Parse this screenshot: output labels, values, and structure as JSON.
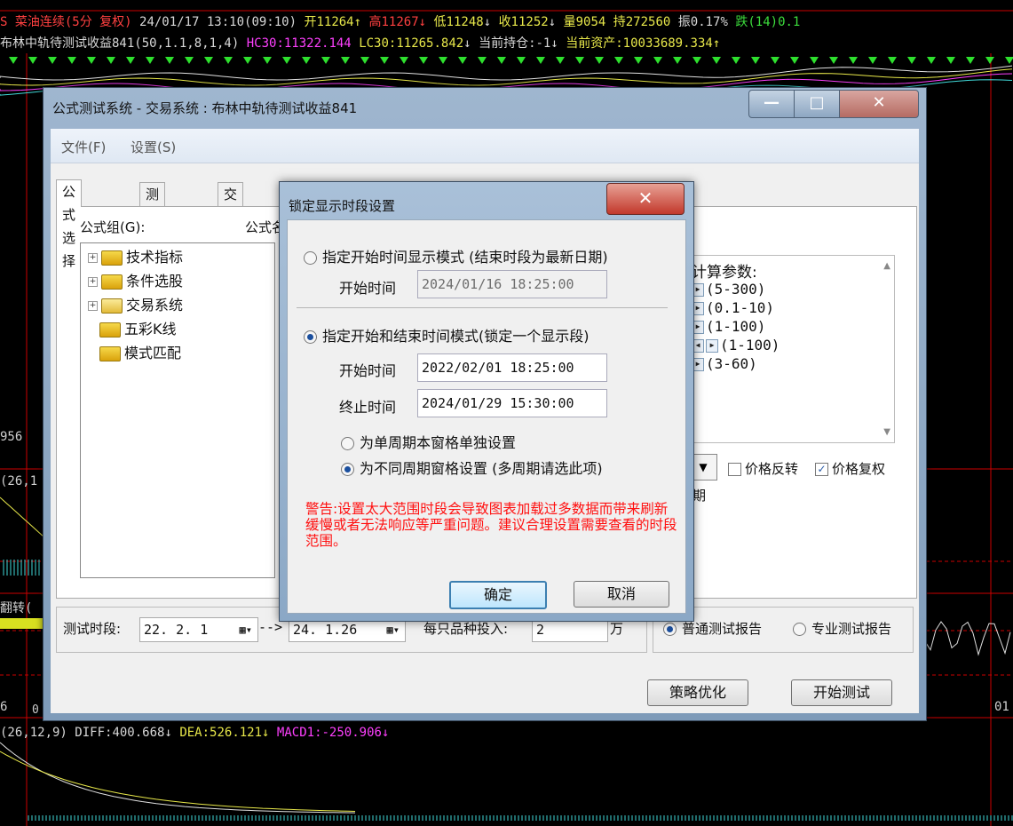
{
  "terminal": {
    "row1": {
      "name": "S 菜油连续(5分 复权)",
      "datetime": "24/01/17 13:10(09:10)",
      "open": "开11264",
      "high": "高11267",
      "low": "低11248",
      "close": "收11252",
      "volume": "量9054",
      "hold": "持272560",
      "amplitude": "振0.17%",
      "change": "跌(14)0.1"
    },
    "row2": {
      "formula": "布林中轨待测试收益841(50,1.1,8,1,4)",
      "hc30": "HC30:11322.144",
      "lc30": "LC30:11265.842",
      "position": "当前持仓:-1",
      "assets": "当前资产:10033689.334"
    },
    "row3": {
      "macd_params": "(26,12,9)",
      "diff": "DIFF:400.668",
      "dea": "DEA:526.121",
      "macd1": "MACD1:-250.906"
    },
    "side_labels": {
      "value_956": "956",
      "param_26": "(26,1",
      "flip": "翻转(",
      "label_6": "6",
      "label_0": "0",
      "label_01": "01"
    }
  },
  "main_window": {
    "title": "公式测试系统 - 交易系统 : 布林中轨待测试收益841",
    "minimize_glyph": "—",
    "maximize_glyph": "□",
    "close_glyph": "✕",
    "menu": [
      "文件(F)",
      "设置(S)"
    ],
    "tabs": [
      "公式选择",
      "测试品种",
      "交易费用"
    ],
    "formula_group_label": "公式组(G):",
    "formula_label": "公式名",
    "tree": [
      {
        "label": "技术指标",
        "expandable": true
      },
      {
        "label": "条件选股",
        "expandable": true
      },
      {
        "label": "交易系统",
        "expandable": true
      },
      {
        "label": "五彩K线",
        "expandable": false
      },
      {
        "label": "模式匹配",
        "expandable": false
      }
    ],
    "params_title": "计算参数:",
    "params": [
      "(5-300)",
      "(0.1-10)",
      "(1-100)",
      "(1-100)",
      "(3-60)"
    ],
    "period_suffix": "期",
    "price_reverse": "价格反转",
    "price_adjust": "价格复权",
    "price_adjust_checked": true,
    "test_period_label": "测试时段:",
    "test_start": "22. 2. 1",
    "arrow": "-->",
    "test_end": "24. 1.26",
    "invest_label": "每只品种投入:",
    "invest_value": "2",
    "invest_unit": "万",
    "report_normal": "普通测试报告",
    "report_pro": "专业测试报告",
    "optimize_button": "策略优化",
    "start_button": "开始测试"
  },
  "dialog": {
    "title": "锁定显示时段设置",
    "close_glyph": "✕",
    "mode1_label": "指定开始时间显示模式 (结束时段为最新日期)",
    "mode1_start_label": "开始时间",
    "mode1_start_value": "2024/01/16 18:25:00",
    "mode2_label": "指定开始和结束时间模式(锁定一个显示段)",
    "mode2_start_label": "开始时间",
    "mode2_start_value": "2022/02/01 18:25:00",
    "mode2_end_label": "终止时间",
    "mode2_end_value": "2024/01/29 15:30:00",
    "sub_option1": "为单周期本窗格单独设置",
    "sub_option2": "为不同周期窗格设置 (多周期请选此项)",
    "warning": "警告:设置太大范围时段会导致图表加载过多数据而带来刷新缓慢或者无法响应等严重问题。建议合理设置需要查看的时段范围。",
    "ok_button": "确定",
    "cancel_button": "取消",
    "selected_mode": 2,
    "selected_sub_option": 2
  }
}
